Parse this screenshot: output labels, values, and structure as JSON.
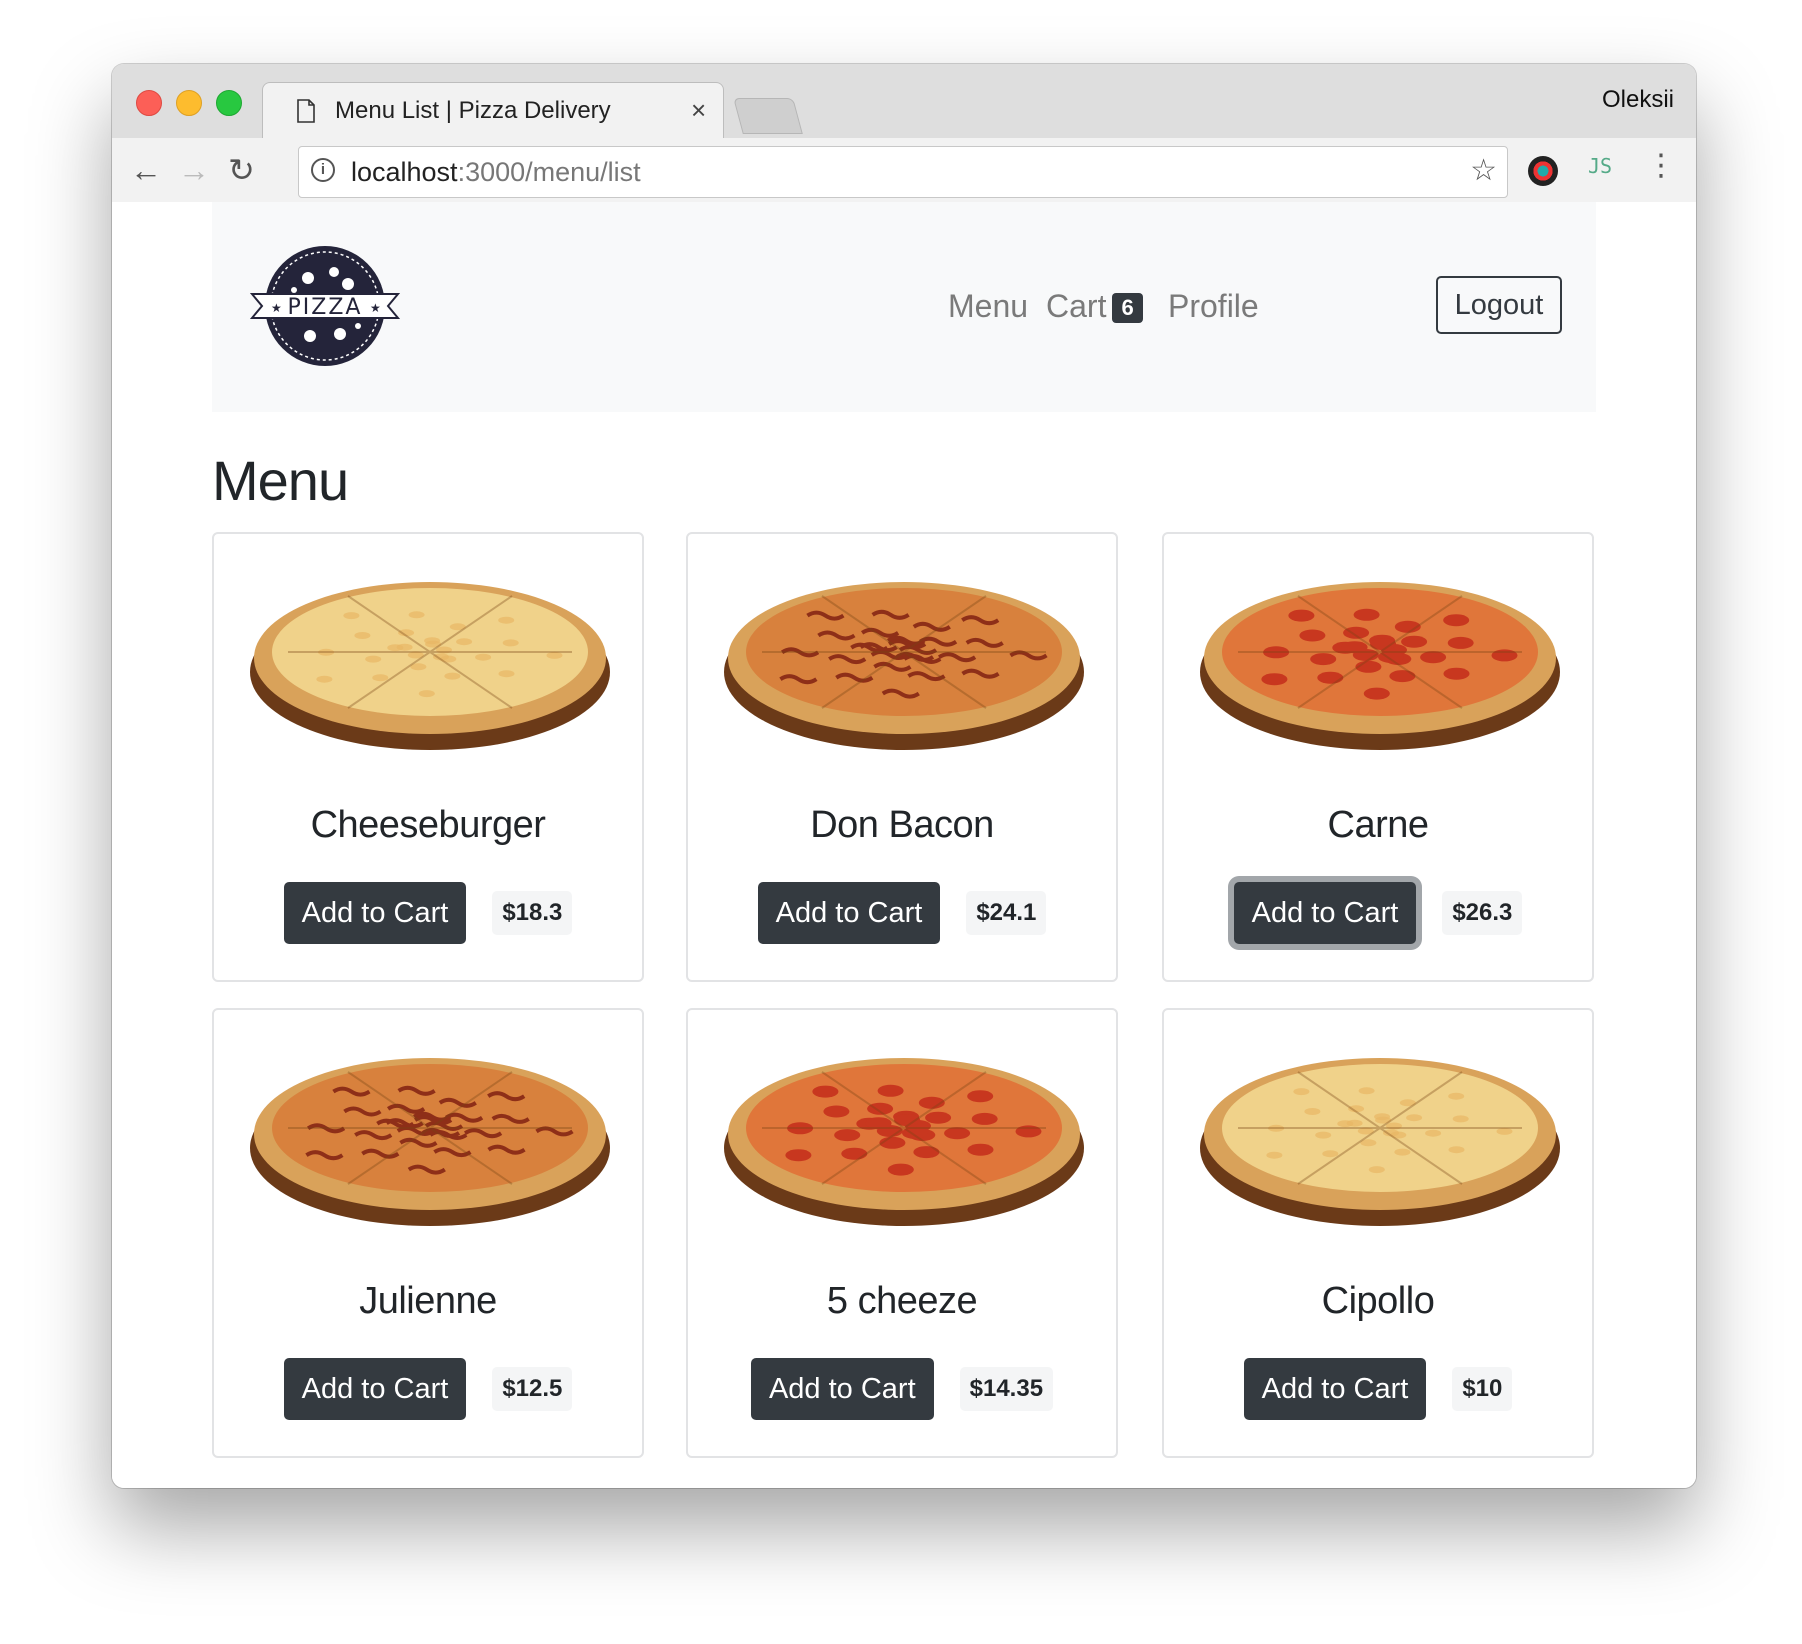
{
  "browser": {
    "tab_title": "Menu List | Pizza Delivery",
    "tab_close": "×",
    "profile_name": "Oleksii",
    "url_host": "localhost",
    "url_path": ":3000/menu/list",
    "back_icon": "←",
    "forward_icon": "→",
    "reload_icon": "↻",
    "star_icon": "☆",
    "menu_icon": "⋮",
    "ext_label": "JS"
  },
  "nav": {
    "logo_text": "PIZZA",
    "links": [
      "Menu",
      "Cart",
      "Profile"
    ],
    "cart_count": "6",
    "logout_label": "Logout"
  },
  "page": {
    "title": "Menu"
  },
  "menu_items": [
    {
      "name": "Cheeseburger",
      "price": "$18.3",
      "button": "Add to Cart",
      "style": "cheese"
    },
    {
      "name": "Don Bacon",
      "price": "$24.1",
      "button": "Add to Cart",
      "style": "bbq"
    },
    {
      "name": "Carne",
      "price": "$26.3",
      "button": "Add to Cart",
      "style": "pepperoni"
    },
    {
      "name": "Julienne",
      "price": "$12.5",
      "button": "Add to Cart",
      "style": "bbq"
    },
    {
      "name": "5 cheeze",
      "price": "$14.35",
      "button": "Add to Cart",
      "style": "pepperoni"
    },
    {
      "name": "Cipollo",
      "price": "$10",
      "button": "Add to Cart",
      "style": "cheese"
    }
  ],
  "colors": {
    "dark_button": "#343a40",
    "navbar_bg": "#f8f9fa",
    "crust": "#d9a25a",
    "cheese": "#f0d28a",
    "pepperoni": "#c8371f",
    "bbq": "#8e2f18",
    "board": "#6b3a18"
  }
}
